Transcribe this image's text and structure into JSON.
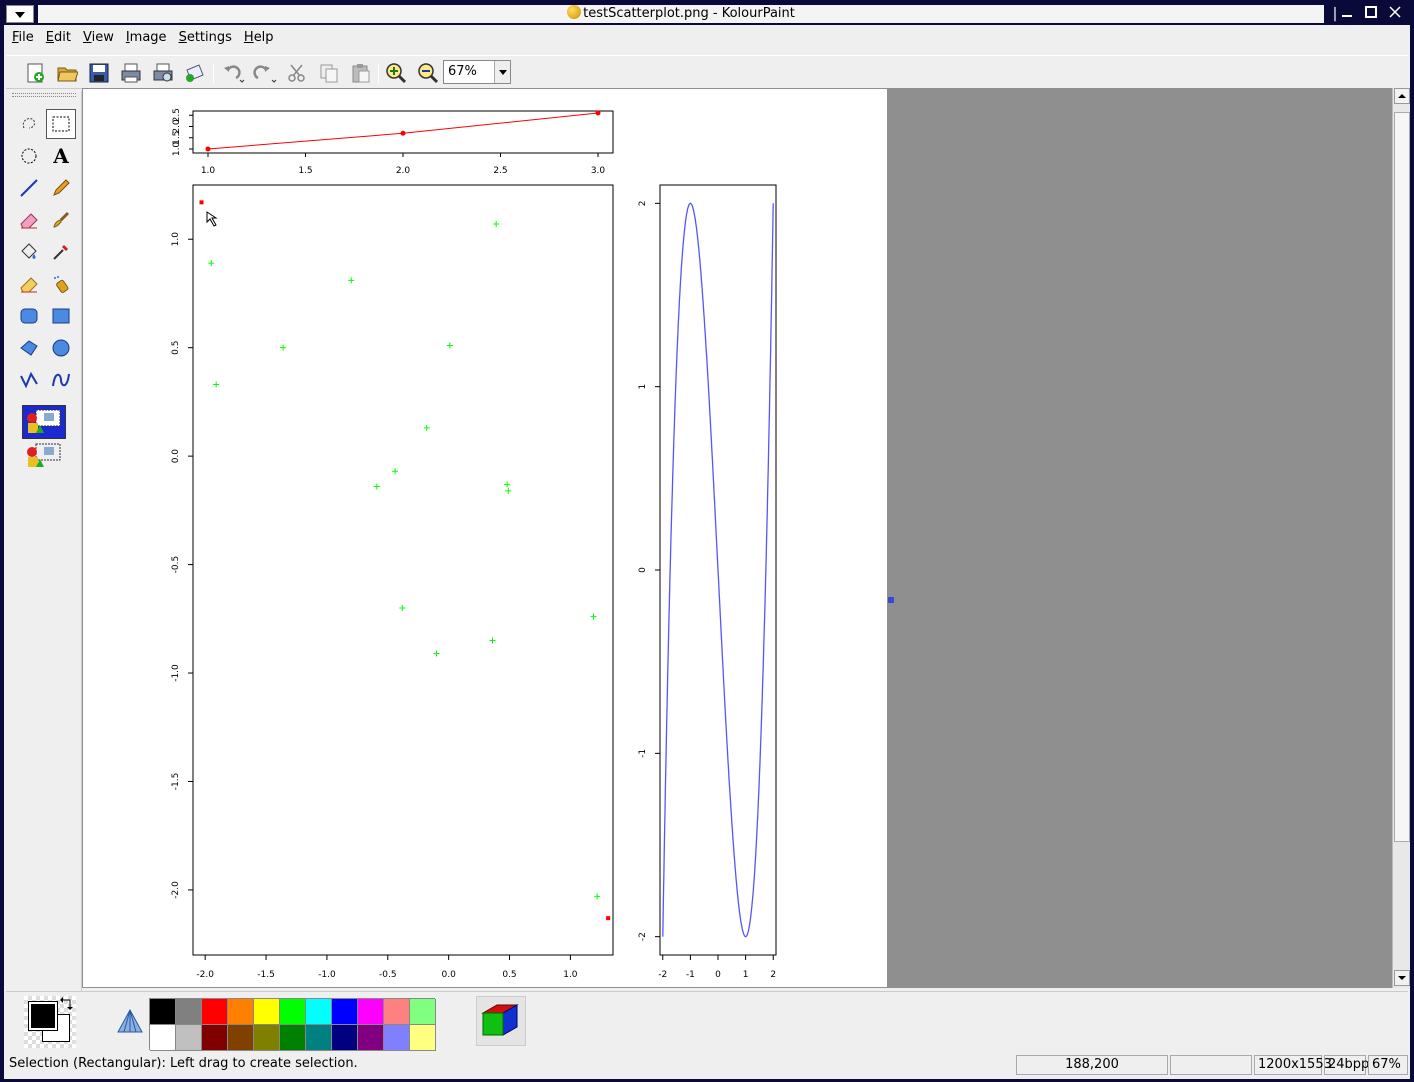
{
  "window": {
    "title": "testScatterplot.png - KolourPaint"
  },
  "menubar": {
    "items": [
      {
        "label": "File",
        "key": "F",
        "rest": "ile"
      },
      {
        "label": "Edit",
        "key": "E",
        "rest": "dit"
      },
      {
        "label": "View",
        "key": "V",
        "rest": "iew"
      },
      {
        "label": "Image",
        "key": "I",
        "rest": "mage"
      },
      {
        "label": "Settings",
        "key": "S",
        "rest": "ettings"
      },
      {
        "label": "Help",
        "key": "H",
        "rest": "elp"
      }
    ]
  },
  "toolbar": {
    "zoom_value": "67%",
    "icons": [
      "new-icon",
      "open-icon",
      "save-icon",
      "print-icon",
      "print-preview-icon",
      "mail-icon",
      "undo-icon",
      "redo-icon",
      "cut-icon",
      "copy-icon",
      "paste-icon",
      "zoom-in-icon",
      "zoom-out-icon"
    ]
  },
  "tools": [
    "freeform-select",
    "rect-select",
    "ellipse-select",
    "text",
    "line",
    "pencil",
    "eraser",
    "brush",
    "flood-fill",
    "color-picker",
    "color-eraser",
    "spraycan",
    "rounded-rect",
    "rectangle",
    "polygon",
    "ellipse",
    "polyline",
    "curve"
  ],
  "palette": {
    "row1": [
      "#000000",
      "#808080",
      "#ff0000",
      "#ff8000",
      "#ffff00",
      "#00ff00",
      "#00ffff",
      "#0000ff",
      "#ff00ff",
      "#ff8080",
      "#80ff80"
    ],
    "row2": [
      "#ffffff",
      "#c0c0c0",
      "#800000",
      "#804000",
      "#808000",
      "#008000",
      "#008080",
      "#000080",
      "#800080",
      "#8080ff",
      "#ffff80"
    ]
  },
  "statusbar": {
    "message": "Selection (Rectangular): Left drag to create selection.",
    "cursor": "188,200",
    "size": "1200x1553",
    "depth": "24bpp",
    "zoom": "67%"
  },
  "chart_data": [
    {
      "type": "line",
      "x": [
        1.0,
        2.0,
        3.0
      ],
      "y": [
        1.0,
        1.7,
        2.6
      ],
      "xticks": [
        "1.0",
        "1.5",
        "2.0",
        "2.5",
        "3.0"
      ],
      "yticks": [
        "1.0",
        "1.5",
        "2.0",
        "2.5"
      ],
      "xlim": [
        1.0,
        3.0
      ],
      "ylim": [
        1.0,
        2.6
      ],
      "color": "#ff0000"
    },
    {
      "type": "scatter",
      "xticks": [
        "-2.0",
        "-1.5",
        "-1.0",
        "-0.5",
        "0.0",
        "0.5",
        "1.0"
      ],
      "yticks": [
        "1.0",
        "0.5",
        "0.0",
        "-0.5",
        "-1.0",
        "-1.5",
        "-2.0"
      ],
      "xlim": [
        -2.1,
        1.35
      ],
      "ylim": [
        -2.3,
        1.25
      ],
      "points": [
        [
          -1.95,
          0.89
        ],
        [
          -1.91,
          0.33
        ],
        [
          -1.36,
          0.5
        ],
        [
          -0.8,
          0.81
        ],
        [
          0.01,
          0.51
        ],
        [
          0.39,
          1.07
        ],
        [
          -0.18,
          0.13
        ],
        [
          -0.44,
          -0.07
        ],
        [
          -0.59,
          -0.14
        ],
        [
          0.48,
          -0.13
        ],
        [
          0.49,
          -0.16
        ],
        [
          -0.38,
          -0.7
        ],
        [
          -0.1,
          -0.91
        ],
        [
          0.36,
          -0.85
        ],
        [
          1.19,
          -0.74
        ],
        [
          1.22,
          -2.03
        ]
      ],
      "highlight": [
        [
          -2.03,
          1.17
        ],
        [
          1.31,
          -2.13
        ]
      ],
      "point_color": "#00ff00",
      "highlight_color": "#ff0000"
    },
    {
      "type": "line",
      "xticks": [
        "-2",
        "-1",
        "0",
        "1",
        "2"
      ],
      "yticks": [
        "2",
        "1",
        "0",
        "-1",
        "-2"
      ],
      "xlim": [
        -2.1,
        2.1
      ],
      "ylim": [
        -2.1,
        2.1
      ],
      "function": "x^3 - 3x",
      "color": "#5555ff"
    }
  ]
}
